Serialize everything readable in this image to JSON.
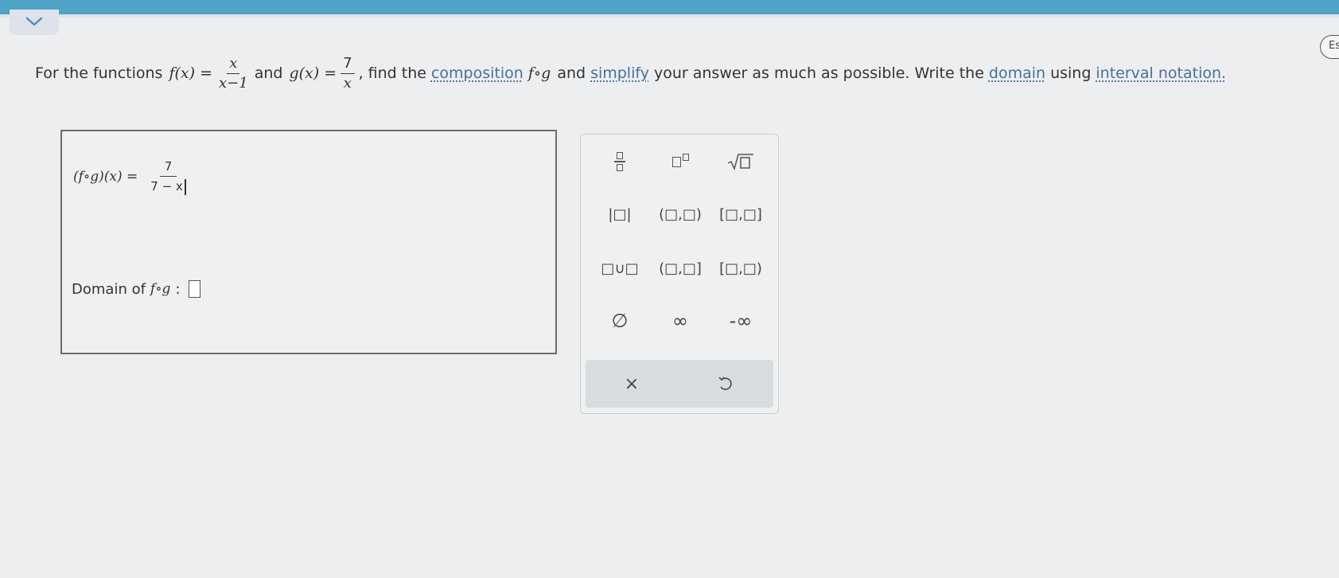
{
  "header": {
    "collapse_icon": "chevron-down-icon",
    "right_badge": "Es"
  },
  "question": {
    "intro": "For the functions",
    "f_lhs": "f(x) =",
    "f_num": "x",
    "f_den": "x−1",
    "and1": "and",
    "g_lhs": "g(x) =",
    "g_num": "7",
    "g_den": "x",
    "comma_find": ", find the",
    "link_composition": "composition",
    "fog": "f∘g",
    "and2": "and",
    "link_simplify": "simplify",
    "mid_text": "your answer as much as possible. Write the",
    "link_domain": "domain",
    "using": "using",
    "link_interval": "interval notation."
  },
  "answer": {
    "comp_lhs": "(f∘g)(x) =",
    "comp_num": "7",
    "comp_den": "7 − x",
    "domain_label": "Domain of",
    "domain_fog": "f∘g",
    "domain_colon": ":"
  },
  "keypad": {
    "row2": [
      "|□|",
      "(□,□)",
      "[□,□]"
    ],
    "row3": [
      "□∪□",
      "(□,□]",
      "[□,□)"
    ],
    "row4": [
      "∅",
      "∞",
      "-∞"
    ],
    "clear": "×",
    "undo_icon": "undo-icon"
  }
}
